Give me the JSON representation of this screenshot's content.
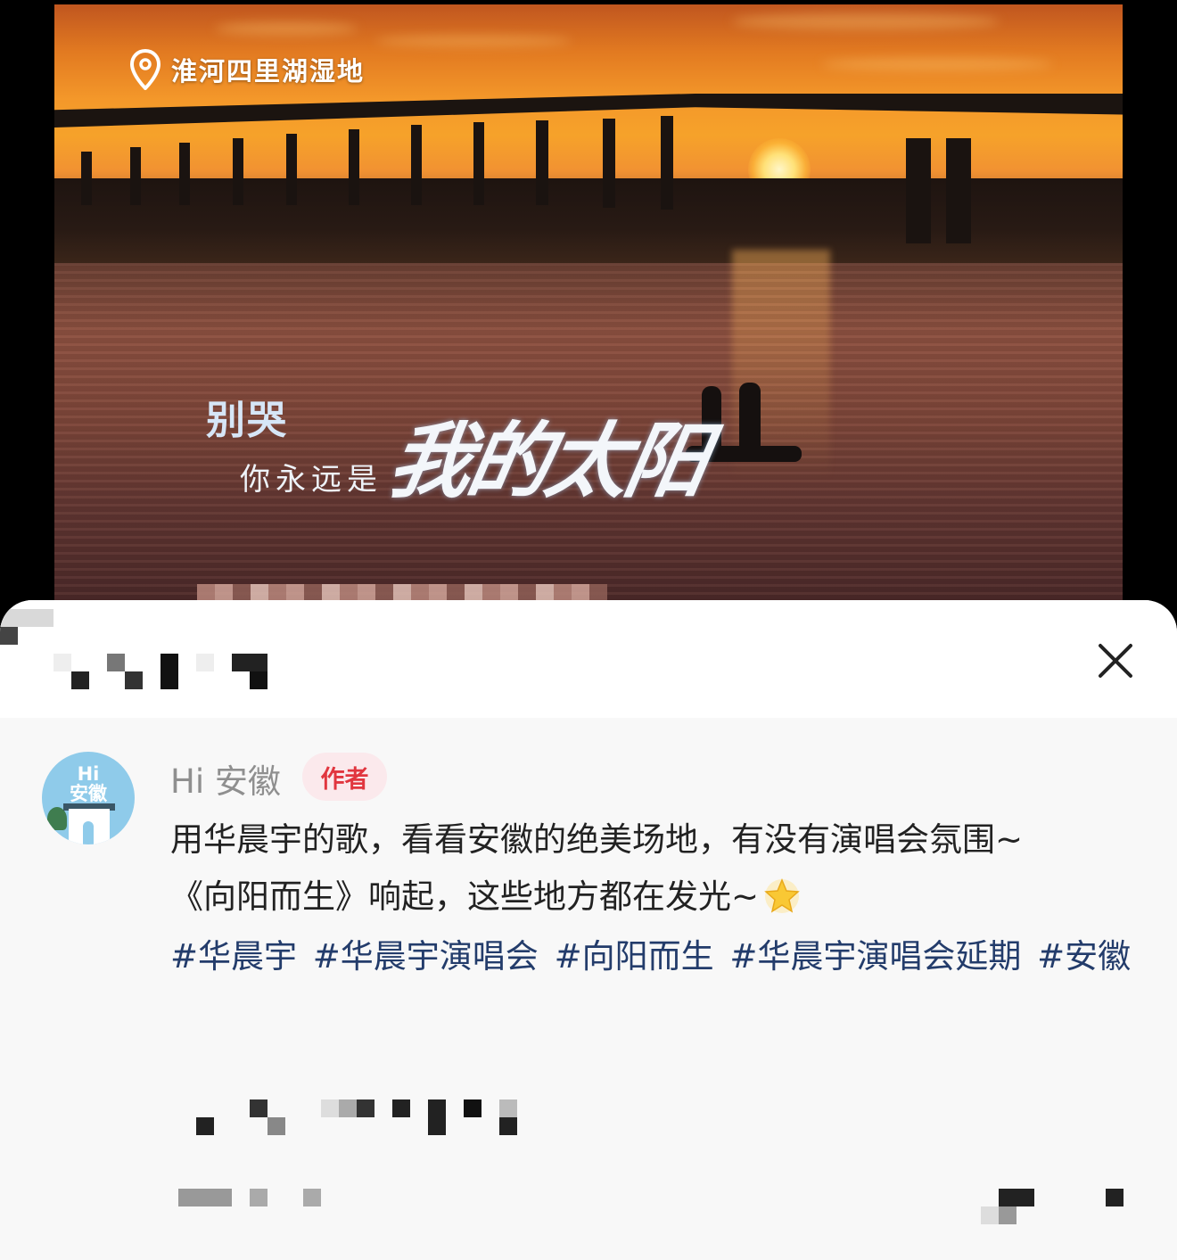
{
  "video": {
    "location_label": "淮河四里湖湿地",
    "lyric_line1": "别哭",
    "lyric_line2": "你永远是",
    "lyric_line3": "我的太阳"
  },
  "sheet": {
    "close_icon": "close-icon"
  },
  "comment": {
    "avatar_text": "Hi\n安徽",
    "author_name": "Hi 安徽",
    "author_badge": "作者",
    "lines": [
      "用华晨宇的歌，看看安徽的绝美场地，有没有演唱会氛围~",
      "《向阳而生》响起，这些地方都在发光~"
    ],
    "emoji_icon": "glowing-star-icon",
    "hashtags": [
      "#华晨宇",
      "#华晨宇演唱会",
      "#向阳而生",
      "#华晨宇演唱会延期",
      "#安徽"
    ]
  }
}
